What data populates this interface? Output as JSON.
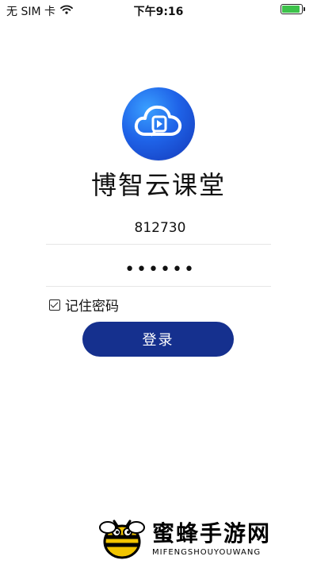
{
  "status_bar": {
    "carrier": "无 SIM 卡",
    "time": "下午9:16",
    "battery_level": 1.0
  },
  "app": {
    "title": "博智云课堂",
    "logo_icon": "cloud-play-icon"
  },
  "login": {
    "username_value": "812730",
    "password_value": "••••••",
    "remember_label": "记住密码",
    "remember_checked": true,
    "submit_label": "登录"
  },
  "watermark": {
    "title": "蜜蜂手游网",
    "subtitle": "MIFENGSHOUYOUWANG",
    "icon": "bee-icon"
  },
  "colors": {
    "primary": "#15308e",
    "logo": "#1f63e8",
    "battery": "#3cc24a"
  }
}
